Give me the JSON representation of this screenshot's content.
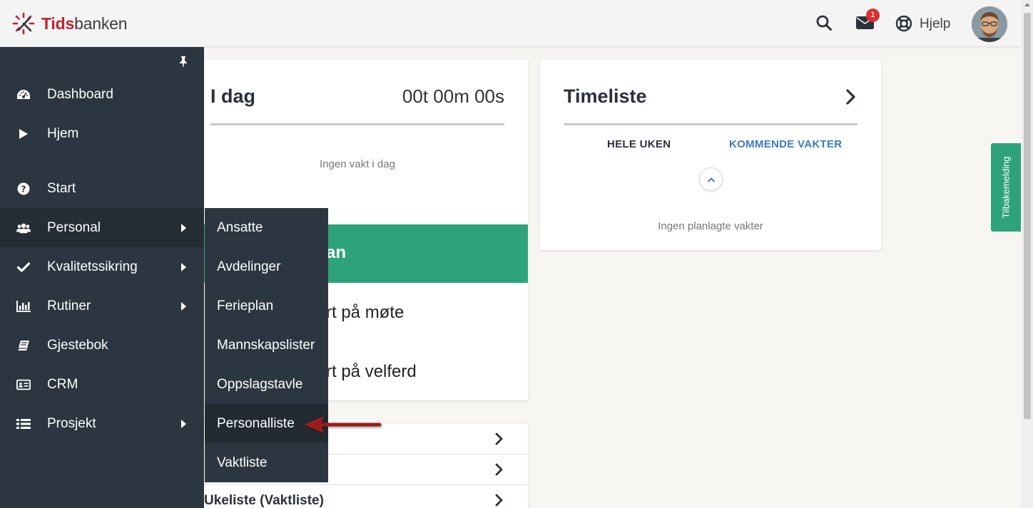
{
  "header": {
    "brand_part1": "Tids",
    "brand_part2": "banken",
    "messages_badge": "1",
    "help_label": "Hjelp"
  },
  "sidebar": {
    "items": [
      {
        "label": "Dashboard",
        "icon": "dashboard-icon"
      },
      {
        "label": "Hjem",
        "icon": "play-icon"
      },
      {
        "label": "Start",
        "icon": "question-icon"
      },
      {
        "label": "Personal",
        "icon": "users-icon",
        "has_submenu": true,
        "active": true
      },
      {
        "label": "Kvalitetssikring",
        "icon": "check-icon",
        "has_submenu": true
      },
      {
        "label": "Rutiner",
        "icon": "bar-chart-icon",
        "has_submenu": true
      },
      {
        "label": "Gjestebok",
        "icon": "book-icon"
      },
      {
        "label": "CRM",
        "icon": "id-card-icon"
      },
      {
        "label": "Prosjekt",
        "icon": "list-icon",
        "has_submenu": true
      }
    ]
  },
  "submenu": {
    "items": [
      "Ansatte",
      "Avdelinger",
      "Ferieplan",
      "Mannskapslister",
      "Oppslagstavle",
      "Personalliste",
      "Vaktliste"
    ],
    "highlighted": "Personalliste"
  },
  "today_card": {
    "title": "I dag",
    "timer": "00t 00m 00s",
    "empty_text": "Ingen vakt i dag",
    "green_text_partial": "an",
    "row1_partial": "rt på møte",
    "row2_partial": "rt på velferd"
  },
  "links_card": {
    "rows": [
      "",
      "",
      "Ukeliste (Vaktliste)"
    ]
  },
  "timesheet_card": {
    "title": "Timeliste",
    "tab_week": "HELE UKEN",
    "tab_upcoming": "KOMMENDE VAKTER",
    "empty_text": "Ingen planlagte vakter"
  },
  "feedback_tab": "Tilbakemelding",
  "colors": {
    "sidebar_bg": "#2c3640",
    "brand_red": "#c5202f",
    "green": "#2ea37a",
    "link_blue": "#3a7bbf",
    "badge_red": "#d93131",
    "annotation_arrow": "#9b1c1c"
  }
}
